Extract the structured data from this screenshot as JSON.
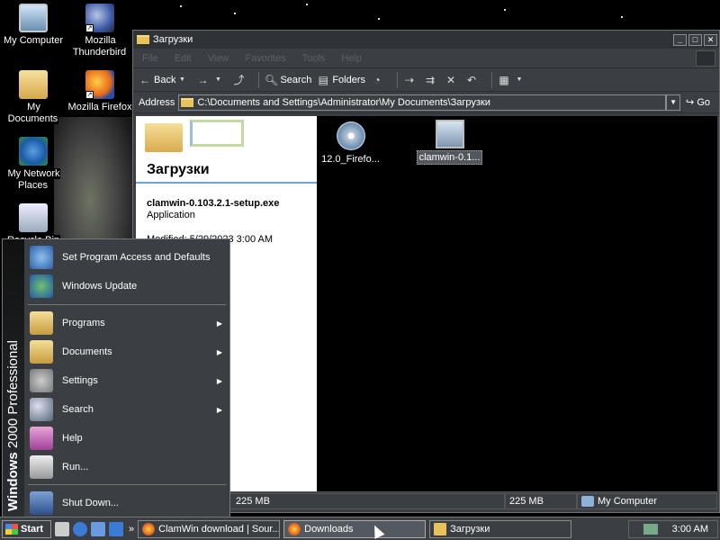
{
  "desktop": {
    "icons": [
      {
        "label": "My Computer"
      },
      {
        "label": "Mozilla Thunderbird"
      },
      {
        "label": "My Documents"
      },
      {
        "label": "Mozilla Firefox"
      },
      {
        "label": "My Network Places"
      },
      {
        "label": "Recycle Bin"
      }
    ]
  },
  "window": {
    "title": "Загрузки",
    "menu": [
      "File",
      "Edit",
      "View",
      "Favorites",
      "Tools",
      "Help"
    ],
    "toolbar": {
      "back": "Back",
      "search": "Search",
      "folders": "Folders"
    },
    "address": {
      "label": "Address",
      "value": "C:\\Documents and Settings\\Administrator\\My Documents\\Загрузки",
      "go": "Go"
    },
    "left_pane": {
      "title": "Загрузки",
      "file_name": "clamwin-0.103.2.1-setup.exe",
      "file_type": "Application",
      "modified": "Modified: 5/29/2023 3:00 AM",
      "partial": "0"
    },
    "files": [
      {
        "label": "12.0_Firefo..."
      },
      {
        "label": "clamwin-0.1..."
      }
    ],
    "status": {
      "size1": "225 MB",
      "size2": "225 MB",
      "zone": "My Computer"
    }
  },
  "start_menu": {
    "banner_brand": "Windows",
    "banner_version": "2000 Professional",
    "items": [
      {
        "label": "Set Program Access and Defaults"
      },
      {
        "label": "Windows Update"
      },
      {
        "label": "Programs"
      },
      {
        "label": "Documents"
      },
      {
        "label": "Settings"
      },
      {
        "label": "Search"
      },
      {
        "label": "Help"
      },
      {
        "label": "Run..."
      },
      {
        "label": "Shut Down..."
      }
    ]
  },
  "taskbar": {
    "start": "Start",
    "tasks": [
      {
        "label": "ClamWin download | Sour..."
      },
      {
        "label": "Downloads"
      },
      {
        "label": "Загрузки"
      }
    ],
    "clock": "3:00 AM"
  }
}
